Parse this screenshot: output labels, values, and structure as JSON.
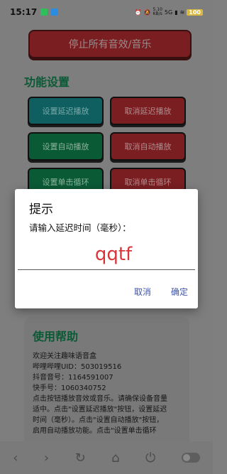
{
  "statusbar": {
    "time": "15:17",
    "net_speed_value": "5.10",
    "net_speed_unit": "KB/s",
    "net_type": "5G",
    "battery": "100"
  },
  "main": {
    "stop_all_label": "停止所有音效/音乐",
    "section_title": "功能设置",
    "buttons": [
      {
        "label": "设置延迟播放"
      },
      {
        "label": "取消延迟播放"
      },
      {
        "label": "设置自动播放"
      },
      {
        "label": "取消自动播放"
      },
      {
        "label": "设置单击循环"
      },
      {
        "label": "取消单击循环"
      }
    ]
  },
  "help": {
    "title": "使用帮助",
    "lines": [
      "欢迎关注趣味语音盒",
      "哔哩哔哩UID：503019516",
      "抖音音号：1164591007",
      "快手号：1060340752",
      "点击按钮播放音效或音乐。请确保设备音量",
      "适中。点击\"设置延迟播放\"按钮，设置延迟",
      "时间（毫秒）。点击\"设置自动播放\"按钮，",
      "启用自动播放功能。点击\"设置单击循环"
    ]
  },
  "dialog": {
    "title": "提示",
    "message": "请输入延迟时间（毫秒）：",
    "input_value": "qqtf",
    "cancel_label": "取消",
    "confirm_label": "确定"
  },
  "colors": {
    "input_text": "#d8343a",
    "dialog_action": "#3e54a8",
    "section_title": "#0a5a36"
  }
}
